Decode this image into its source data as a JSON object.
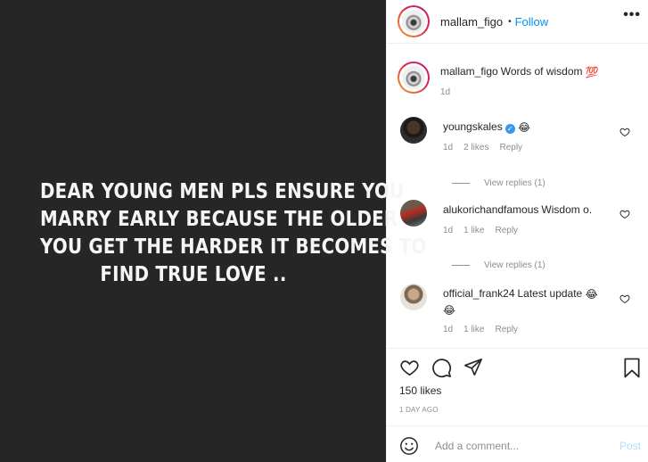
{
  "media": {
    "lines": [
      "DEAR YOUNG MEN PLS ENSURE YOU",
      "MARRY EARLY BECAUSE THE OLDER",
      "YOU GET THE HARDER IT BECOMES TO",
      "FIND TRUE LOVE .."
    ]
  },
  "header": {
    "username": "mallam_figo",
    "separator": "•",
    "follow_label": "Follow",
    "more_label": "•••"
  },
  "caption": {
    "username": "mallam_figo",
    "text": "Words of wisdom",
    "emoji": "💯",
    "time": "1d"
  },
  "comments": [
    {
      "username": "youngskales",
      "verified_mark": "✓",
      "text": "😂",
      "time": "1d",
      "likes": "2 likes",
      "reply_label": "Reply",
      "view_replies": "View replies (1)"
    },
    {
      "username": "alukorichandfamous",
      "text": "Wisdom o.",
      "time": "1d",
      "likes": "1 like",
      "reply_label": "Reply",
      "view_replies": "View replies (1)"
    },
    {
      "username": "official_frank24",
      "text": "Latest update",
      "emoji1": "😂",
      "emoji2": "😂",
      "time": "1d",
      "likes": "1 like",
      "reply_label": "Reply"
    }
  ],
  "post": {
    "likes": "150 likes",
    "time_ago": "1 DAY AGO"
  },
  "add_comment": {
    "placeholder": "Add a comment...",
    "post_label": "Post"
  },
  "icons": {
    "heart": "heart-icon",
    "comment": "comment-icon",
    "share": "share-icon",
    "save": "bookmark-icon",
    "smile": "smile-icon",
    "more": "more-icon"
  }
}
